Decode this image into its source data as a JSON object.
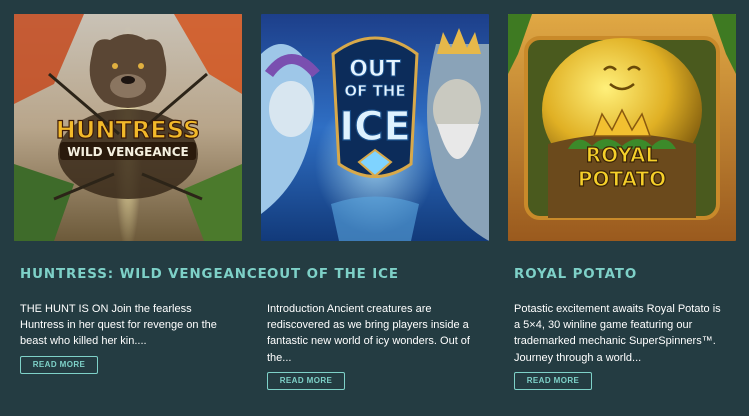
{
  "games": [
    {
      "title": "HUNTRESS: WILD VENGEANCE",
      "logo_line1": "HUNTRESS",
      "logo_line2": "WILD VENGEANCE",
      "description": "THE HUNT IS ON Join the fearless Huntress in her quest for revenge on the beast who killed her kin....",
      "button": "READ MORE"
    },
    {
      "title": "OUT OF THE ICE",
      "logo_line1": "OUT",
      "logo_line2": "OF THE",
      "logo_line3": "ICE",
      "description": "Introduction Ancient creatures are rediscovered as we bring players inside a fantastic new world of icy wonders. Out of the...",
      "button": "READ MORE"
    },
    {
      "title": "ROYAL POTATO",
      "logo_line1": "ROYAL",
      "logo_line2": "POTATO",
      "description": "Potastic excitement awaits Royal Potato is a 5×4, 30 winline game featuring our trademarked mechanic SuperSpinners™. Journey through a world...",
      "button": "READ MORE"
    }
  ],
  "colors": {
    "background": "#243c42",
    "accent": "#7ed1c8"
  }
}
